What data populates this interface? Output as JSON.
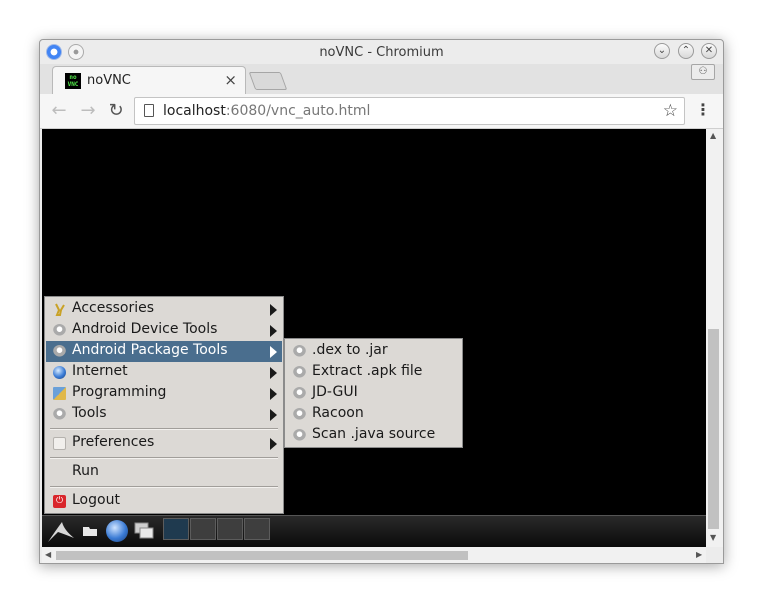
{
  "window": {
    "title": "noVNC - Chromium"
  },
  "tab": {
    "title": "noVNC",
    "favicon_text_1": "no",
    "favicon_text_2": "VNC",
    "close_glyph": "×"
  },
  "toolbar": {
    "url_host": "localhost",
    "url_rest": ":6080/vnc_auto.html"
  },
  "start_menu": {
    "items": [
      {
        "label": "Accessories",
        "icon": "accessories-icon",
        "submenu": true
      },
      {
        "label": "Android Device Tools",
        "icon": "app-generic-icon",
        "submenu": true
      },
      {
        "label": "Android Package Tools",
        "icon": "gear-icon",
        "submenu": true,
        "highlighted": true
      },
      {
        "label": "Internet",
        "icon": "globe-icon",
        "submenu": true
      },
      {
        "label": "Programming",
        "icon": "programming-icon",
        "submenu": true
      },
      {
        "label": "Tools",
        "icon": "app-generic-icon",
        "submenu": true
      },
      {
        "label": "Preferences",
        "icon": "preferences-icon",
        "submenu": true
      },
      {
        "label": "Run",
        "icon": "",
        "submenu": false
      },
      {
        "label": "Logout",
        "icon": "logout-icon",
        "submenu": false
      }
    ]
  },
  "submenu": {
    "items": [
      {
        "label": ".dex to .jar"
      },
      {
        "label": "Extract .apk file"
      },
      {
        "label": "JD-GUI"
      },
      {
        "label": "Racoon"
      },
      {
        "label": "Scan .java source"
      }
    ]
  },
  "colors": {
    "menu_bg": "#dcd9d5",
    "highlight": "#4a6e8e",
    "desktop": "#000000"
  }
}
